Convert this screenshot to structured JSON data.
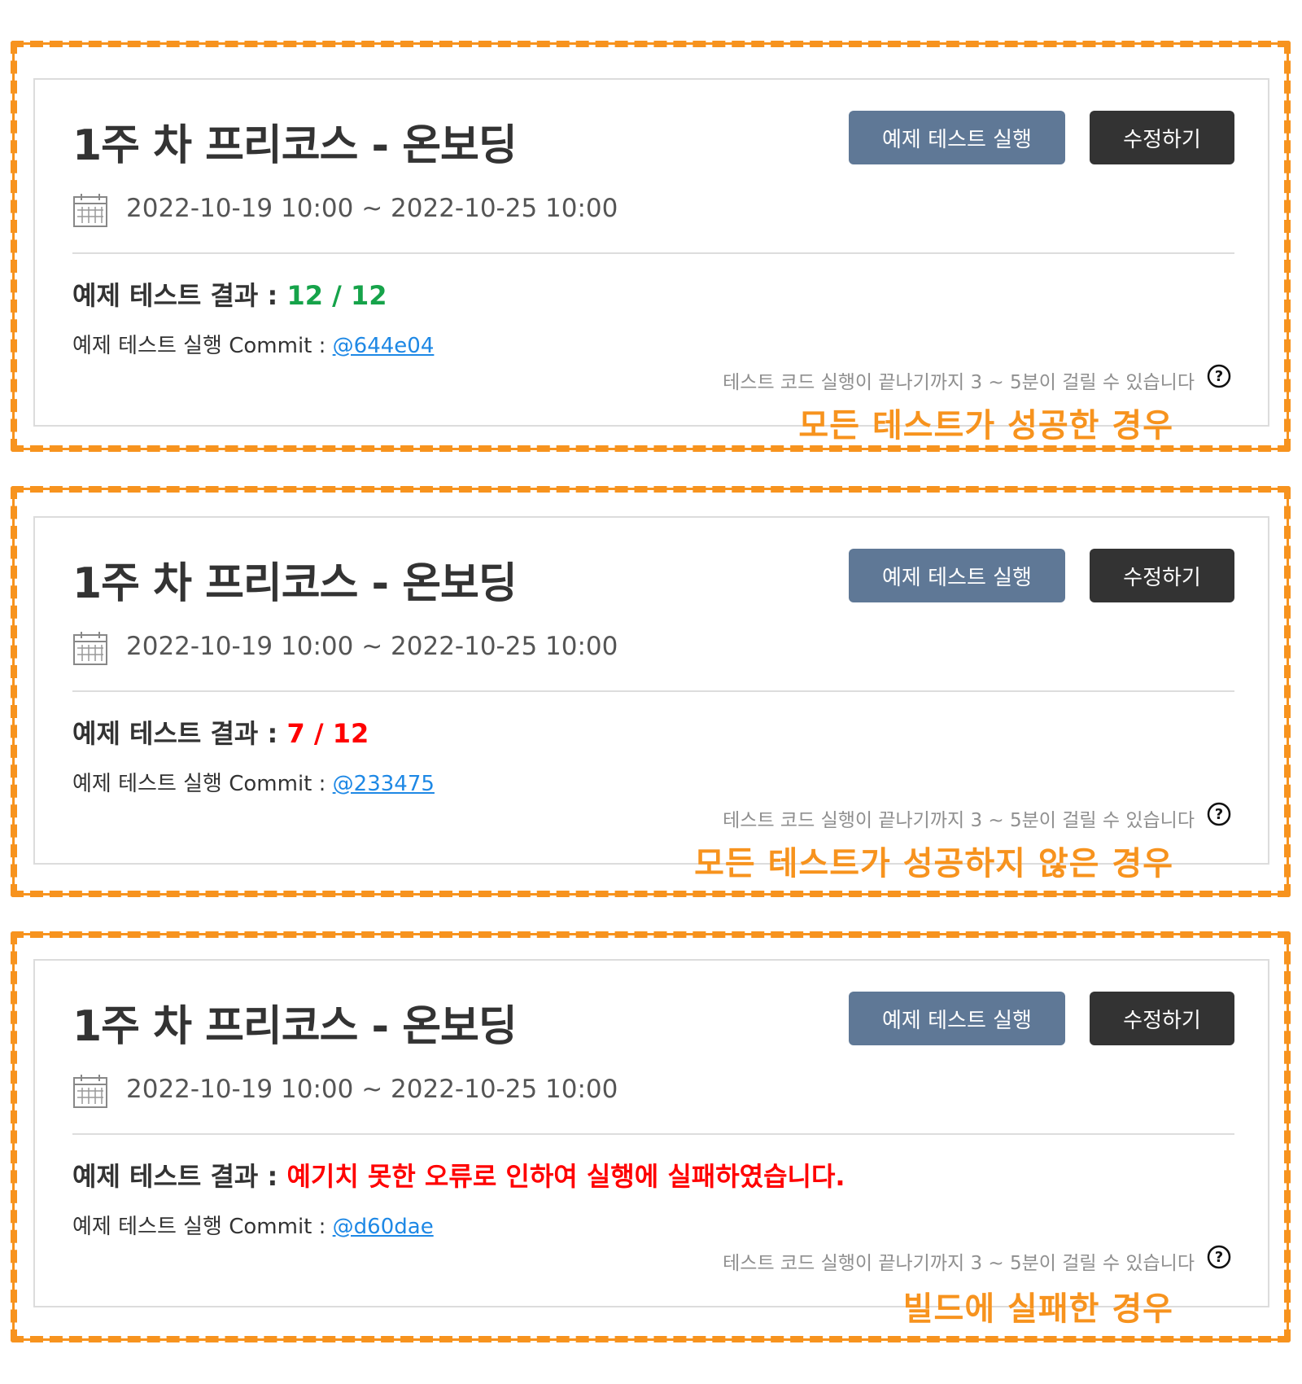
{
  "colors": {
    "accent_orange": "#f7931e",
    "success_green": "#16a34a",
    "error_red": "#ff0000",
    "link_blue": "#1e88e5",
    "run_button": "#5f7896",
    "edit_button": "#333333"
  },
  "cards": [
    {
      "title": "1주 차 프리코스 - 온보딩",
      "run_button": "예제 테스트 실행",
      "edit_button": "수정하기",
      "period": "2022-10-19 10:00 ~ 2022-10-25 10:00",
      "result_label": "예제 테스트 결과 :",
      "result_value": "12 / 12",
      "commit_label": "예제 테스트 실행 Commit :",
      "commit_link": "@644e04",
      "note": "테스트 코드 실행이 끝나기까지 3 ~ 5분이 걸릴 수 있습니다",
      "caption": "모든 테스트가 성공한 경우"
    },
    {
      "title": "1주 차 프리코스 - 온보딩",
      "run_button": "예제 테스트 실행",
      "edit_button": "수정하기",
      "period": "2022-10-19 10:00 ~ 2022-10-25 10:00",
      "result_label": "예제 테스트 결과 :",
      "result_value": "7 / 12",
      "commit_label": "예제 테스트 실행 Commit :",
      "commit_link": "@233475",
      "note": "테스트 코드 실행이 끝나기까지 3 ~ 5분이 걸릴 수 있습니다",
      "caption": "모든 테스트가 성공하지 않은 경우"
    },
    {
      "title": "1주 차 프리코스 - 온보딩",
      "run_button": "예제 테스트 실행",
      "edit_button": "수정하기",
      "period": "2022-10-19 10:00 ~ 2022-10-25 10:00",
      "result_label": "예제 테스트 결과 :",
      "result_value": "예기치 못한 오류로 인하여 실행에 실패하였습니다.",
      "commit_label": "예제 테스트 실행 Commit :",
      "commit_link": "@d60dae",
      "note": "테스트 코드 실행이 끝나기까지 3 ~ 5분이 걸릴 수 있습니다",
      "caption": "빌드에 실패한 경우"
    }
  ]
}
